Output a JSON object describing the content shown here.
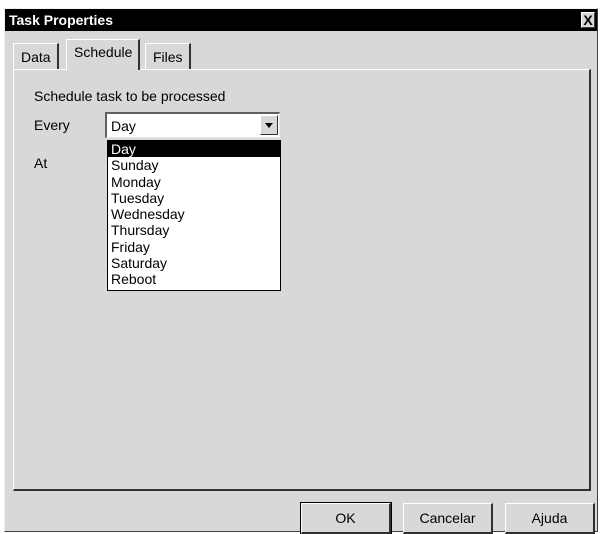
{
  "window": {
    "title": "Task Properties",
    "close_glyph": "X",
    "close_icon": "close-icon"
  },
  "tabs": [
    {
      "label": "Data",
      "active": false
    },
    {
      "label": "Schedule",
      "active": true
    },
    {
      "label": "Files",
      "active": false
    }
  ],
  "schedule": {
    "heading": "Schedule task to be processed",
    "every_label": "Every",
    "at_label": "At",
    "every_value": "Day",
    "options": [
      "Day",
      "Sunday",
      "Monday",
      "Tuesday",
      "Wednesday",
      "Thursday",
      "Friday",
      "Saturday",
      "Reboot"
    ],
    "highlighted_option": "Day"
  },
  "buttons": {
    "ok": "OK",
    "cancel": "Cancelar",
    "help": "Ajuda"
  }
}
